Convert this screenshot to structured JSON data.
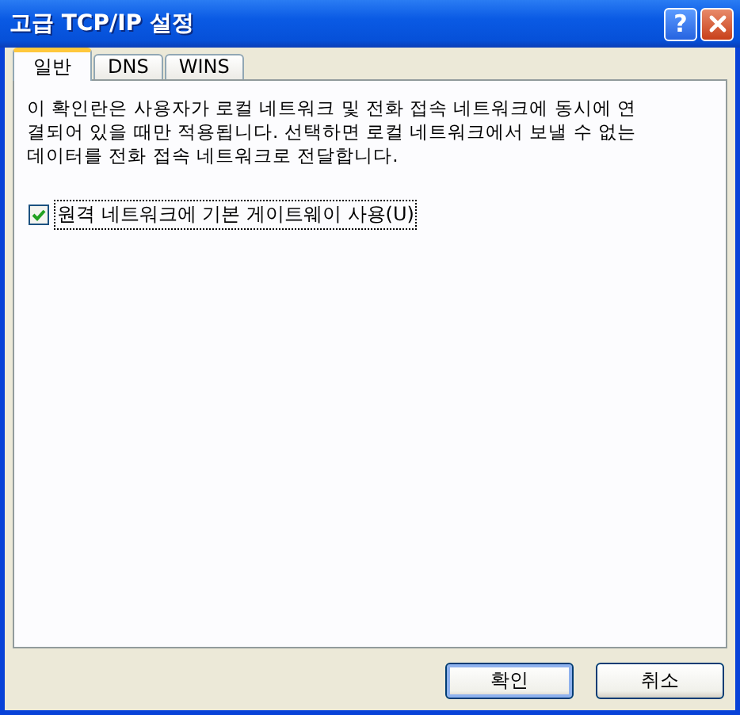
{
  "window": {
    "title": "고급 TCP/IP 설정"
  },
  "title_buttons": [
    {
      "kind": "help",
      "label": "?"
    },
    {
      "kind": "close"
    }
  ],
  "tabs": [
    {
      "label": "일반",
      "selected": true
    },
    {
      "label": "DNS",
      "selected": false
    },
    {
      "label": "WINS",
      "selected": false
    }
  ],
  "description": "이 확인란은 사용자가 로컬 네트워크 및 전화 접속 네트워크에 동시에 연결되어 있을 때만 적용됩니다. 선택하면 로컬 네트워크에서 보낼 수 없는 데이터를 전화 접속 네트워크로 전달합니다.",
  "checkbox": {
    "label": "원격 네트워크에 기본 게이트웨이 사용(U)",
    "checked": true,
    "focused": true
  },
  "buttons": [
    {
      "label": "확인",
      "default": true
    },
    {
      "label": "취소",
      "default": false
    }
  ]
}
